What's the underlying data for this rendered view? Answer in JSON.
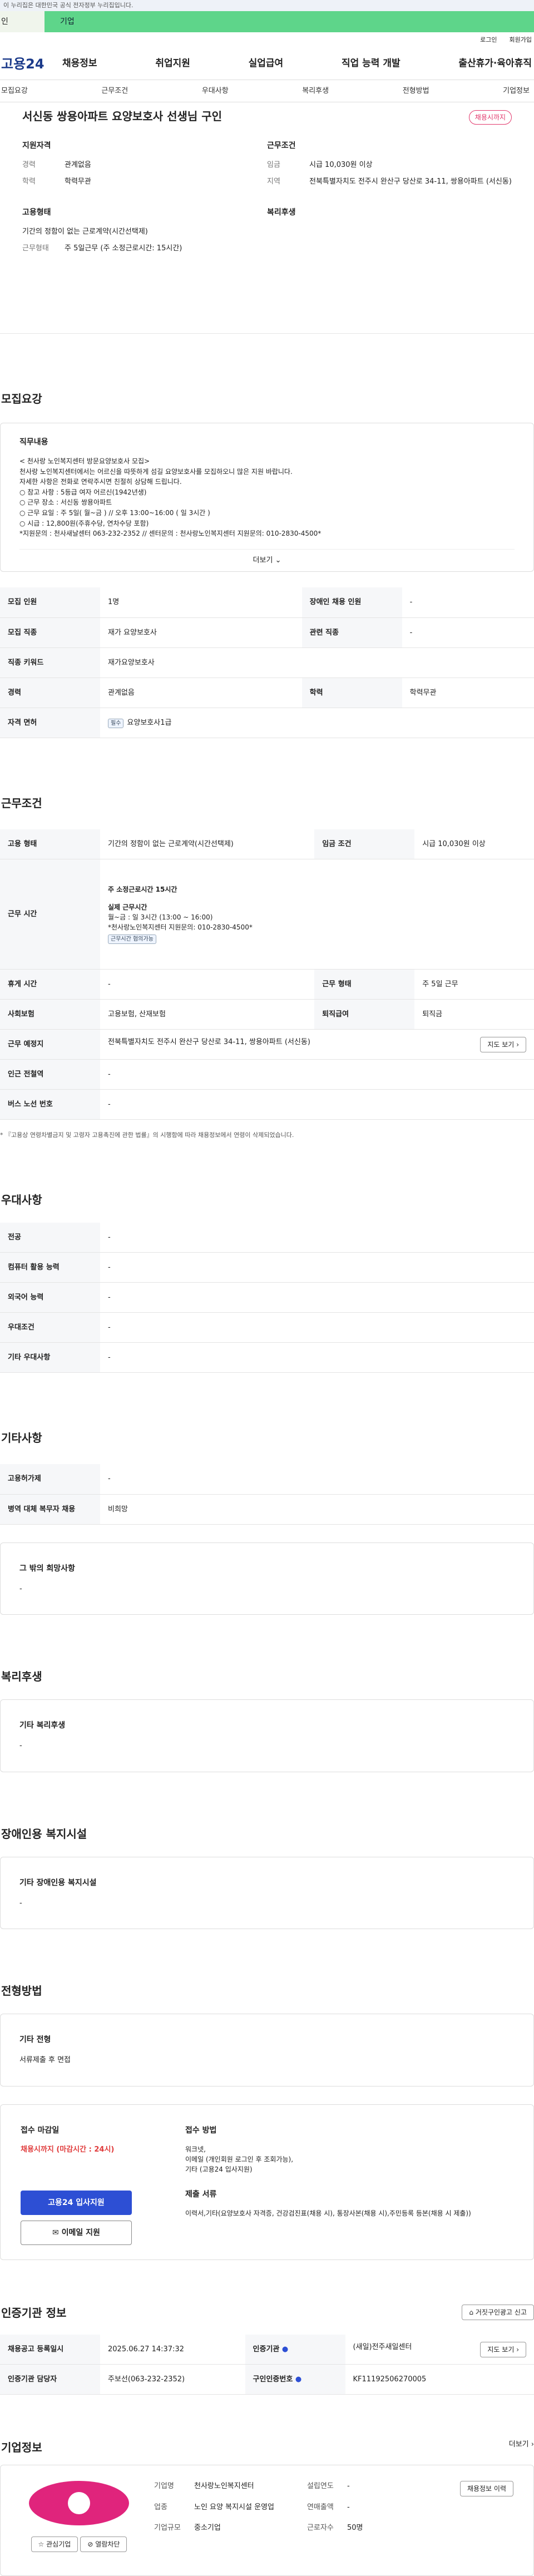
{
  "top": {
    "gov_notice": "이 누리집은 대한민국 공식 전자정부 누리집입니다.",
    "tab_individual": "인",
    "tab_company": "기업",
    "login": "로그인",
    "join": "회원가입"
  },
  "gnb": {
    "logo": "고용24",
    "menu": [
      "채용정보",
      "취업지원",
      "실업급여",
      "직업 능력 개발",
      "출산휴가·육아휴직"
    ]
  },
  "snb": [
    "모집요강",
    "근무조건",
    "우대사항",
    "복리후생",
    "전형방법",
    "기업정보"
  ],
  "summary": {
    "title": "서신동 쌍용아파트 요양보호사 선생님 구인",
    "badge": "채용시까지",
    "qual_h": "지원자격",
    "career_k": "경력",
    "career_v": "관계없음",
    "edu_k": "학력",
    "edu_v": "학력무관",
    "work_h": "근무조건",
    "wage_k": "임금",
    "wage_v": "시급 10,030원 이상",
    "area_k": "지역",
    "area_v": "전북특별자치도 전주시 완산구 당산로 34-11, 쌍용아파트 (서신동)",
    "emp_h": "고용형태",
    "emp_v": "기간의 정함이 없는 근로계약(시간선택제)",
    "type_k": "근무형태",
    "type_v": "주 5일근무 (주 소정근로시간: 15시간)",
    "welfare_h": "복리후생"
  },
  "recruit": {
    "title": "모집요강",
    "job_h": "직무내용",
    "lines": [
      "< 천사랑 노인복지센터 방문요양보호사 모집>",
      "",
      "천사랑 노인복지센터에서는 어르신을 따뜻하게 섬길 요양보호사를 모집하오니 많은 지원 바랍니다.",
      "자세한 사항은 전화로 연락주시면 친절히 상담해 드립니다.",
      "○ 참고 사항 : 5등급 여자 어르신(1942년생)",
      "○ 근무 장소 : 서신동 쌍용아파트",
      "○ 근무 요일 : 주 5일( 월~금 ) // 오후 13:00~16:00 ( 일 3시간 )",
      "○ 시급 : 12,800원(주휴수당, 연차수당 포함)",
      "*지원문의 : 천사새날센터 063-232-2352 // 센터문의 : 천사랑노인복지센터 지원문의: 010-2830-4500*"
    ],
    "more": "더보기",
    "rows": [
      [
        "모집 인원",
        "1명",
        "장애인 채용 인원",
        "-"
      ],
      [
        "모집 직종",
        "재가 요양보호사",
        "관련 직종",
        "-"
      ],
      [
        "직종 키워드",
        "재가요양보호사",
        "",
        ""
      ],
      [
        "경력",
        "관계없음",
        "학력",
        "학력무관"
      ]
    ],
    "license_k": "자격 면허",
    "license_tag": "필수",
    "license_v": "요양보호사1급"
  },
  "cond": {
    "title": "근무조건",
    "emp_k": "고용 형태",
    "emp_v": "기간의 정함이 없는 근로계약(시간선택제)",
    "wage_k": "임금 조건",
    "wage_v": "시급 10,030원 이상",
    "time_k": "근무 시간",
    "time_1": "주 소정근로시간 15시간",
    "time_2": "실제 근무시간",
    "time_3": "월~금 : 일 3시간 (13:00 ~ 16:00)",
    "time_4": "*천사랑노인복지센터 지원문의: 010-2830-4500*",
    "time_tag": "근무시간 협의가능",
    "rest_k": "휴게 시간",
    "rest_v": "-",
    "form_k": "근무 형태",
    "form_v": "주 5일 근무",
    "ins_k": "사회보험",
    "ins_v": "고용보험, 산재보험",
    "ret_k": "퇴직급여",
    "ret_v": "퇴직금",
    "place_k": "근무 예정지",
    "place_v": "전북특별자치도 전주시 완산구 당산로 34-11, 쌍용아파트 (서신동)",
    "map_btn": "지도 보기",
    "sub_k": "인근 전철역",
    "sub_v": "-",
    "bus_k": "버스 노선 번호",
    "bus_v": "-",
    "note": "* 『고용상 연령차별금지 및 고령자 고용촉진에 관한 법률』의 시행함에 따라 채용정보에서 연령이 삭제되었습니다."
  },
  "pref": {
    "title": "우대사항",
    "rows": [
      [
        "전공",
        "-"
      ],
      [
        "컴퓨터 활용 능력",
        "-"
      ],
      [
        "외국어 능력",
        "-"
      ],
      [
        "우대조건",
        "-"
      ],
      [
        "기타 우대사항",
        "-"
      ]
    ]
  },
  "etc": {
    "title": "기타사항",
    "rows": [
      [
        "고용허가제",
        "-"
      ],
      [
        "병역 대체 복무자 채용",
        "비희망"
      ]
    ],
    "hope_h": "그 밖의 희망사항",
    "hope_v": "-"
  },
  "welfare": {
    "title": "복리후생",
    "h": "기타 복리후생",
    "v": "-"
  },
  "disab": {
    "title": "장애인용 복지시설",
    "h": "기타 장애인용 복지시설",
    "v": "-"
  },
  "screen": {
    "title": "전형방법",
    "h": "기타 전형",
    "v": "서류제출 후 면접",
    "deadline_h": "접수 마감일",
    "deadline_v": "채용시까지 (마감시간 : 24시)",
    "method_h": "접수 방법",
    "method_v": [
      "워크넷,",
      "이메일 (개인회원 로그인 후 조회가능),",
      "기타 (고용24 입사지원)"
    ],
    "docs_h": "제출 서류",
    "docs_v": "이력서,기타(요양보호사 자격증, 건강검진표(채용 시), 통장사본(채용 시),주민등록 등본(채용 시 제출))",
    "apply_btn": "고용24 입사지원",
    "email_btn": "이메일 지원"
  },
  "cert": {
    "title": "인증기관 정보",
    "report_btn": "거짓구인광고 신고",
    "reg_k": "채용공고 등록일시",
    "reg_v": "2025.06.27 14:37:32",
    "org_k": "인증기관",
    "org_v": "(새일)전주새일센터",
    "map_btn": "지도 보기",
    "mgr_k": "인증기관 담당자",
    "mgr_v": "주보선(063-232-2352)",
    "id_k": "구인인증번호",
    "id_v": "KF11192506270005"
  },
  "company": {
    "title": "기업정보",
    "more": "더보기",
    "fav_btn": "관심기업",
    "block_btn": "열람차단",
    "name_k": "기업명",
    "name_v": "천사랑노인복지센터",
    "ind_k": "업종",
    "ind_v": "노인 요양 복지시설 운영업",
    "size_k": "기업규모",
    "size_v": "중소기업",
    "est_k": "설립연도",
    "est_v": "-",
    "sales_k": "연매출액",
    "sales_v": "-",
    "emp_k": "근로자수",
    "emp_v": "50명",
    "hist_btn": "채용정보 이력"
  }
}
